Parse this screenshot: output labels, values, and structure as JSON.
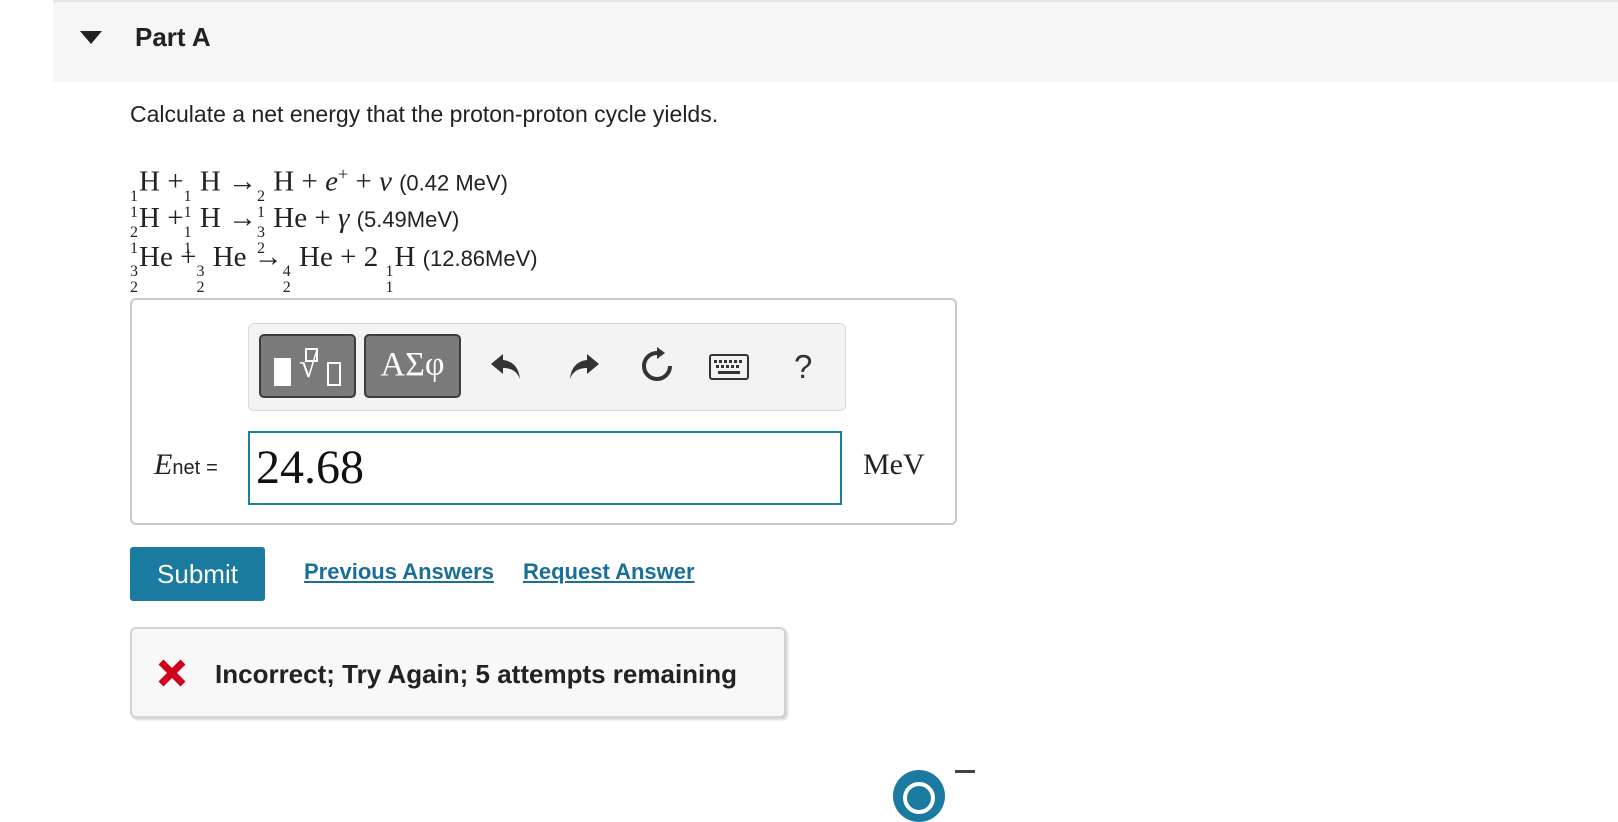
{
  "part": {
    "title": "Part A"
  },
  "question": {
    "prompt": "Calculate a net energy that the proton-proton cycle yields.",
    "reactions": {
      "r1": {
        "t1": "H",
        "plus1": "+",
        "t2": " H",
        "arrow": "→",
        "t3": " H",
        "plus2": "+",
        "e": "e",
        "eplus": "+",
        "plus3": "+",
        "nu": "ν",
        "energy": "(0.42 MeV)",
        "n1a": "1",
        "n1b": "1",
        "n2a": "1",
        "n2b": "1",
        "n3a": "2",
        "n3b": "1"
      },
      "r2": {
        "t1": "H",
        "plus1": "+",
        "t2": " H",
        "arrow": "→",
        "t3": " He",
        "plus2": "+",
        "gamma": "γ",
        "energy": "(5.49MeV)",
        "n1a": "2",
        "n1b": "1",
        "n2a": "1",
        "n2b": "1",
        "n3a": "3",
        "n3b": "2"
      },
      "r3": {
        "t1": "He",
        "plus1": "+",
        "t2": " He",
        "arrow": "→",
        "t3": " He",
        "plus2": "+",
        "coef": "2",
        "t4": "H",
        "energy": "(12.86MeV)",
        "n1a": "3",
        "n1b": "2",
        "n2a": "3",
        "n2b": "2",
        "n3a": "4",
        "n3b": "2",
        "n4a": "1",
        "n4b": "1"
      }
    }
  },
  "toolbar": {
    "greek_label": "ΑΣφ",
    "help_label": "?",
    "icons": [
      "templates-icon",
      "undo-icon",
      "redo-icon",
      "reset-icon",
      "keyboard-icon",
      "help-icon"
    ]
  },
  "answer": {
    "var": "E",
    "sub": "net",
    "eq": "=",
    "value": "24.68",
    "unit": "MeV"
  },
  "actions": {
    "submit": "Submit",
    "previous": "Previous Answers",
    "request": "Request Answer"
  },
  "feedback": {
    "text": "Incorrect; Try Again; 5 attempts remaining",
    "color": "#d0021b"
  },
  "colors": {
    "accent": "#1a7aa0",
    "link": "#1a6f9a",
    "input_border": "#1b7fa3"
  }
}
